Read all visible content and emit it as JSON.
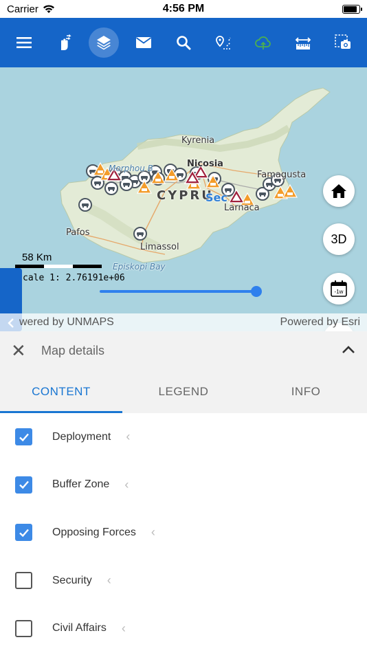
{
  "status_bar": {
    "carrier": "Carrier",
    "time": "4:56 PM",
    "battery_level": 0.95
  },
  "toolbar": {
    "buttons": [
      {
        "name": "menu-icon"
      },
      {
        "name": "touch-gesture-icon"
      },
      {
        "name": "layers-icon",
        "active": true
      },
      {
        "name": "mail-icon"
      },
      {
        "name": "search-icon"
      },
      {
        "name": "route-pin-icon"
      },
      {
        "name": "cloud-sync-icon",
        "color": "#4caf50"
      },
      {
        "name": "ruler-icon"
      },
      {
        "name": "screenshot-camera-icon"
      }
    ],
    "background": "#1565c8"
  },
  "map": {
    "places": {
      "kyrenia": "Kyrenia",
      "nicosia": "Nicosia",
      "famagusta": "Famagusta",
      "cyprus": "CYPRU",
      "larnaca": "Larnaca",
      "pafos": "Pafos",
      "limassol": "Limassol",
      "morphou": "Morphou B",
      "episkopi": "Episkopi Bay",
      "sec": "Sec"
    },
    "scale_label": "58 Km",
    "scale_text": "cale 1:  2.76191e+06",
    "attribution_left": "wered by UNMAPS",
    "attribution_right": "Powered by Esri",
    "buttons": {
      "home": "home-icon",
      "three_d": "3D",
      "time": "-1w"
    },
    "timeline_value": 1.0
  },
  "panel": {
    "title": "Map details",
    "tabs": [
      {
        "label": "CONTENT",
        "active": true
      },
      {
        "label": "LEGEND",
        "active": false
      },
      {
        "label": "INFO",
        "active": false
      }
    ],
    "layers": [
      {
        "label": "Deployment",
        "checked": true
      },
      {
        "label": "Buffer Zone",
        "checked": true
      },
      {
        "label": "Opposing Forces",
        "checked": true
      },
      {
        "label": "Security",
        "checked": false
      },
      {
        "label": "Civil Affairs",
        "checked": false
      }
    ]
  }
}
